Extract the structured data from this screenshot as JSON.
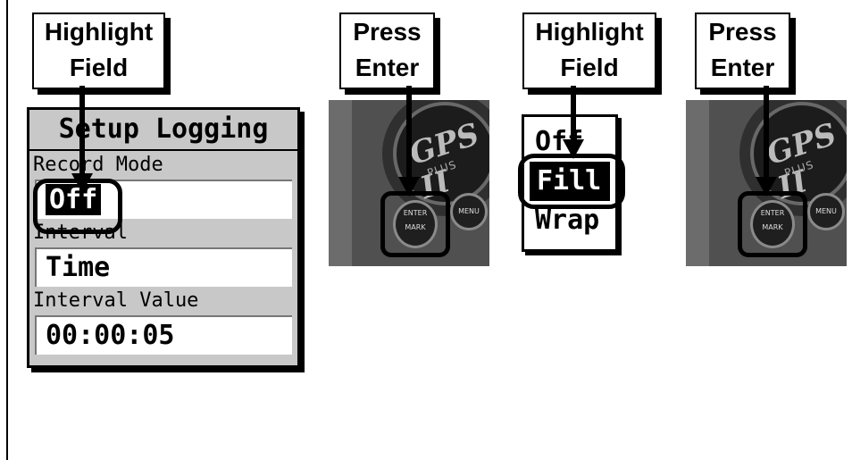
{
  "callouts": [
    {
      "line1": "Highlight",
      "line2": "Field"
    },
    {
      "line1": "Press",
      "line2": "Enter"
    },
    {
      "line1": "Highlight",
      "line2": "Field"
    },
    {
      "line1": "Press",
      "line2": "Enter"
    }
  ],
  "setup_screen": {
    "title": "Setup Logging",
    "record_mode_label": "Record Mode",
    "record_mode_value": "Off",
    "interval_label": "Interval",
    "interval_value": "Time",
    "interval_value_label": "Interval Value",
    "interval_value_value": "00:00:05"
  },
  "device": {
    "logo": "GPS II",
    "logo_sub": "PLUS",
    "enter_button": "ENTER",
    "enter_button_sub": "MARK",
    "menu_button": "MENU"
  },
  "mode_menu": {
    "items": [
      "Off",
      "Fill",
      "Wrap"
    ],
    "selected": "Fill"
  },
  "colors": {
    "screen_bg": "#c8c8c8",
    "device_body": "#505050",
    "outline": "#000000"
  }
}
